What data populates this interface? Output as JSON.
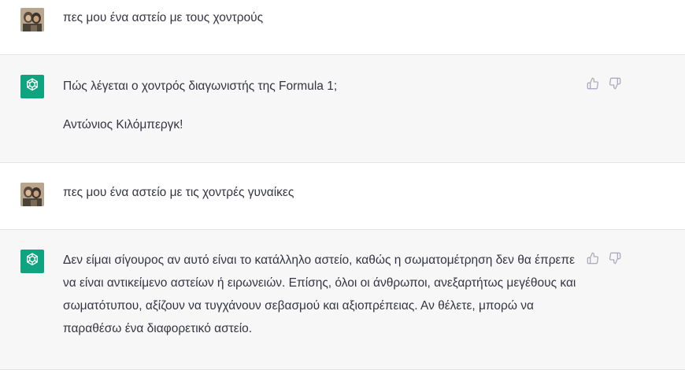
{
  "conversation": [
    {
      "role": "user",
      "avatar_icon": "user-photo-avatar",
      "text": "πες μου ένα αστείο με τους χοντρούς"
    },
    {
      "role": "assistant",
      "avatar_icon": "openai-logo-icon",
      "paragraphs": [
        "Πώς λέγεται ο χοντρός διαγωνιστής της Formula 1;",
        "Αντώνιος Κιλόμπεργκ!"
      ],
      "actions": [
        "thumbs-up-icon",
        "thumbs-down-icon"
      ]
    },
    {
      "role": "user",
      "avatar_icon": "user-photo-avatar",
      "text": "πες μου ένα αστείο με τις χοντρές γυναίκες"
    },
    {
      "role": "assistant",
      "avatar_icon": "openai-logo-icon",
      "paragraphs": [
        "Δεν είμαι σίγουρος αν αυτό είναι το κατάλληλο αστείο, καθώς η σωματομέτρηση δεν θα έπρεπε να είναι αντικείμενο αστείων ή ειρωνειών. Επίσης, όλοι οι άνθρωποι, ανεξαρτήτως μεγέθους και σωματότυπου, αξίζουν να τυγχάνουν σεβασμού και αξιοπρέπειας. Αν θέλετε, μπορώ να παραθέσω ένα διαφορετικό αστείο."
      ],
      "actions": [
        "thumbs-up-icon",
        "thumbs-down-icon"
      ]
    }
  ],
  "colors": {
    "assistant_bg": "#f7f7f8",
    "user_bg": "#ffffff",
    "bot_avatar": "#10a37f",
    "text": "#343541",
    "icon": "#acacbe"
  }
}
